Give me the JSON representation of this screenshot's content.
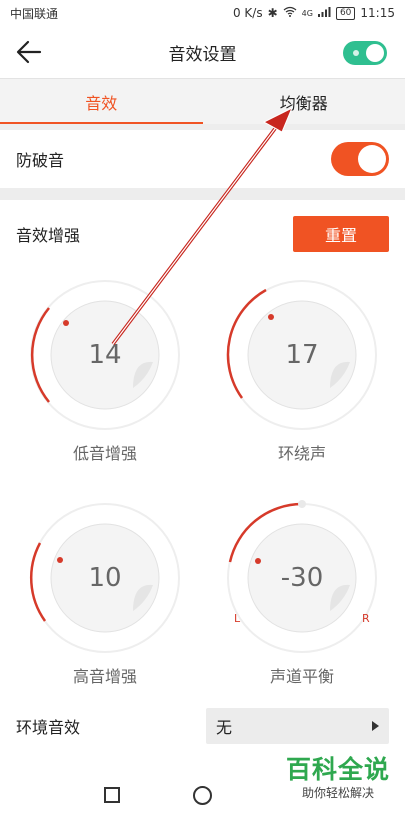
{
  "status_bar": {
    "carrier": "中国联通",
    "network_speed": "0 K/s",
    "signal_label": "4G",
    "battery": "60",
    "time": "11:15"
  },
  "header": {
    "title": "音效设置",
    "back_icon": "arrow-left-icon",
    "master_toggle_on": true,
    "toggle_color": "#2fbf90"
  },
  "tabs": [
    {
      "label": "音效",
      "active": true
    },
    {
      "label": "均衡器",
      "active": false
    }
  ],
  "anti_burst": {
    "label": "防破音",
    "on": true
  },
  "enhance": {
    "title": "音效增强",
    "reset_label": "重置"
  },
  "knobs": [
    {
      "id": "bass",
      "value": "14",
      "label": "低音增强"
    },
    {
      "id": "surround",
      "value": "17",
      "label": "环绕声"
    },
    {
      "id": "treble",
      "value": "10",
      "label": "高音增强"
    },
    {
      "id": "balance",
      "value": "-30",
      "label": "声道平衡",
      "left_mark": "L",
      "right_mark": "R"
    }
  ],
  "environment": {
    "label": "环境音效",
    "selected": "无"
  },
  "watermark": {
    "title": "百科全说",
    "subtitle": "助你轻松解决"
  },
  "colors": {
    "accent": "#f05323",
    "arc": "#d63a2a",
    "watermark": "#2fa84f"
  }
}
